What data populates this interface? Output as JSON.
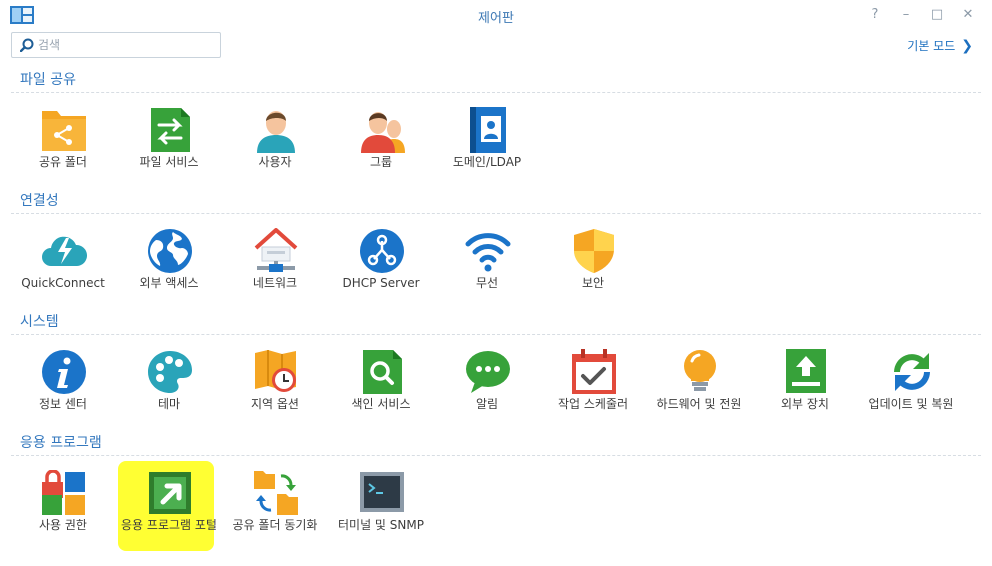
{
  "window": {
    "title": "제어판",
    "buttons": [
      "?",
      "–",
      "□",
      "✕"
    ]
  },
  "search": {
    "placeholder": "검색",
    "value": ""
  },
  "basic_mode": {
    "label": "기본 모드"
  },
  "sections": [
    {
      "title": "파일 공유",
      "items": [
        "공유 폴더",
        "파일 서비스",
        "사용자",
        "그룹",
        "도메인/LDAP"
      ]
    },
    {
      "title": "연결성",
      "items": [
        "QuickConnect",
        "외부 액세스",
        "네트워크",
        "DHCP Server",
        "무선",
        "보안"
      ]
    },
    {
      "title": "시스템",
      "items": [
        "정보 센터",
        "테마",
        "지역 옵션",
        "색인 서비스",
        "알림",
        "작업 스케줄러",
        "하드웨어 및 전원",
        "외부 장치",
        "업데이트 및 복원"
      ]
    },
    {
      "title": "응용 프로그램",
      "items": [
        "사용 권한",
        "응용 프로그램 포털",
        "공유 폴더 동기화",
        "터미널 및 SNMP"
      ]
    }
  ],
  "colors": {
    "accent": "#3478be",
    "highlight": "#ffff33"
  }
}
